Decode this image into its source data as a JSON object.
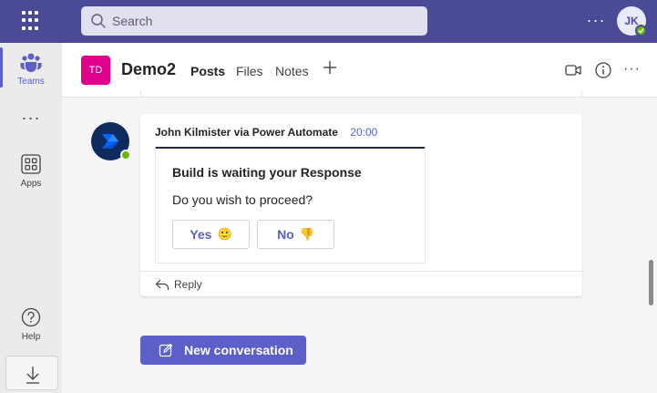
{
  "topbar": {
    "search_placeholder": "Search",
    "more_label": "···",
    "user_initials": "JK"
  },
  "rail": {
    "teams_label": "Teams",
    "more_label": "···",
    "apps_label": "Apps",
    "help_label": "Help"
  },
  "channel": {
    "team_initials": "TD",
    "team_name": "Demo2",
    "tabs": [
      {
        "label": "Posts",
        "active": true
      },
      {
        "label": "Files"
      },
      {
        "label": "Notes"
      }
    ],
    "more_label": "···"
  },
  "message": {
    "author": "John Kilmister via Power Automate",
    "time": "20:00",
    "card_title": "Build is waiting your Response",
    "card_body": "Do you wish to proceed?",
    "yes_label": "Yes",
    "yes_emoji": "🙂",
    "no_label": "No",
    "no_emoji": "👎",
    "reply_label": "Reply"
  },
  "compose": {
    "new_conversation_label": "New conversation"
  },
  "colors": {
    "topbar": "#4b4a96",
    "accent": "#5b5fc7",
    "team_avatar": "#e3008c",
    "presence": "#6bb700"
  }
}
